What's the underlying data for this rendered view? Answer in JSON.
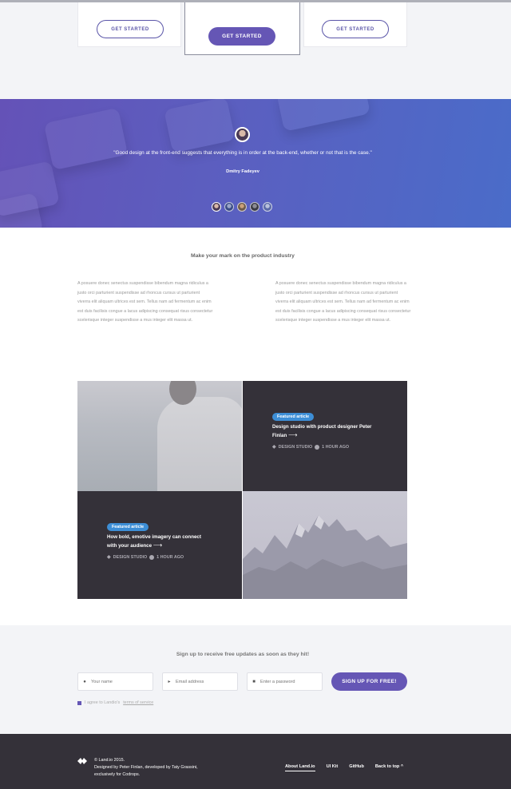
{
  "pricing": {
    "left_button": "GET STARTED",
    "middle_button": "GET STARTED",
    "right_button": "GET STARTED"
  },
  "testimonial": {
    "quote": "\"Good design at the front-end suggests that everything is in order at the back-end, whether or not that is the case.\"",
    "author": "Dmitry Fadeyev",
    "thumbnail_count": 5,
    "active_thumbnail": 0
  },
  "content": {
    "title": "Make your mark on the product industry",
    "paragraph_left": "A posuere donec senectus suspendisse bibendum magna ridiculus a justo orci parturient suspendisse ad rhoncus cursus ut parturient viverra elit aliquam ultrices est sem. Tellus nam ad fermentum ac enim est duis facilisis congue a lacus adipiscing consequat risus consectetur scelerisque integer suspendisse a mus integer elit massa ut.",
    "paragraph_right": "A posuere donec senectus suspendisse bibendum magna ridiculus a justo orci parturient suspendisse ad rhoncus cursus ut parturient viverra elit aliquam ultrices est sem. Tellus nam ad fermentum ac enim est duis facilisis congue a lacus adipiscing consequat risus consectetur scelerisque integer suspendisse a mus integer elit massa ut."
  },
  "articles": [
    {
      "badge": "Featured article",
      "title": "Design studio with product designer Peter Finlan",
      "arrow": "⟶",
      "category": "DESIGN STUDIO",
      "time": "1 HOUR AGO"
    },
    {
      "badge": "Featured article",
      "title": "How bold, emotive imagery can connect with your audience",
      "arrow": "⟶",
      "category": "DESIGN STUDIO",
      "time": "1 HOUR AGO"
    }
  ],
  "signup": {
    "title": "Sign up to receive free updates as soon as they hit!",
    "name_placeholder": "Your name",
    "email_placeholder": "Email address",
    "password_placeholder": "Enter a password",
    "button": "SIGN UP FOR FREE!",
    "agree_text": "I agree to Landio's",
    "terms_link": "terms of service"
  },
  "footer": {
    "copyright": "© Land.io 2015.",
    "credits": "Designed by Peter Finlan, developed by Taty Grassini, exclusively for Codrops.",
    "nav": [
      "About Land.io",
      "UI Kit",
      "GitHub",
      "Back to top"
    ],
    "back_to_top_icon": "^"
  },
  "colors": {
    "accent": "#6556b5",
    "badge": "#3d8ed6",
    "dark": "#343139"
  }
}
